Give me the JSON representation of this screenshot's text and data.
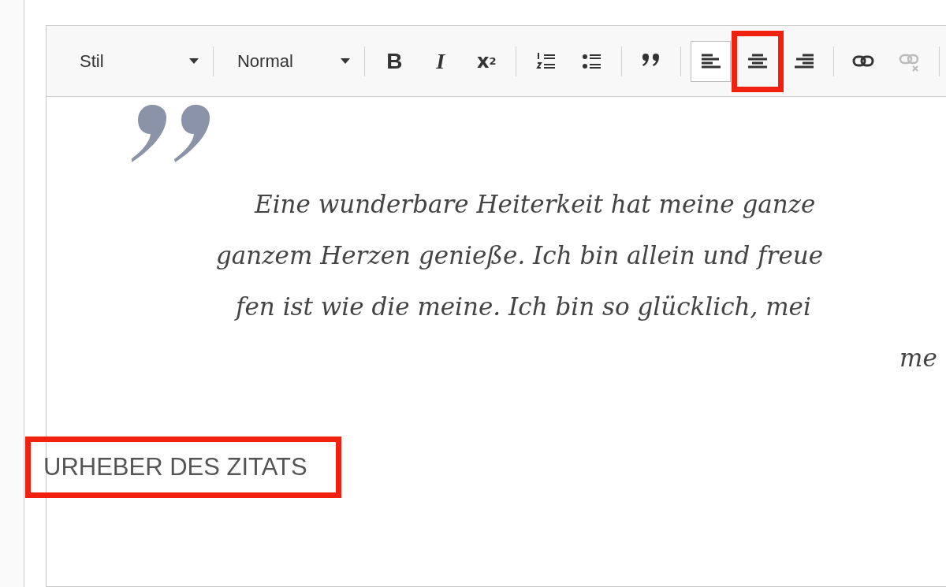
{
  "toolbar": {
    "items": [
      {
        "kind": "dropdown",
        "label": "Stil"
      },
      {
        "kind": "separator"
      },
      {
        "kind": "dropdown",
        "label": "Normal"
      },
      {
        "kind": "separator"
      },
      {
        "kind": "text",
        "label": "B"
      },
      {
        "kind": "text",
        "label": "I"
      },
      {
        "kind": "text",
        "label": "x$^{2}$"
      },
      {
        "kind": "separator"
      },
      {
        "kind": "icon"
      },
      {
        "kind": "icon"
      },
      {
        "kind": "separator"
      },
      {
        "kind": "icon"
      },
      {
        "kind": "separator"
      },
      {
        "kind": "icon",
        "selected": true
      },
      {
        "kind": "icon",
        "selected": false,
        "highlighted": true
      },
      {
        "kind": "icon",
        "selected": false
      },
      {
        "kind": "separator"
      },
      {
        "kind": "icon",
        "disabled": false
      },
      {
        "kind": "icon",
        "disabled": true
      },
      {
        "kind": "separator"
      }
    ]
  },
  "content": {
    "quote_lines": [
      "Eine wunderbare Heiterkeit hat meine ganze",
      "ganzem Herzen genieße. Ich bin allein und freue",
      "fen ist wie die meine. Ich bin so glücklich, mei",
      "me"
    ],
    "attribution": {
      "text": "URHEBER DES ZITATS",
      "highlighted": true
    }
  }
}
